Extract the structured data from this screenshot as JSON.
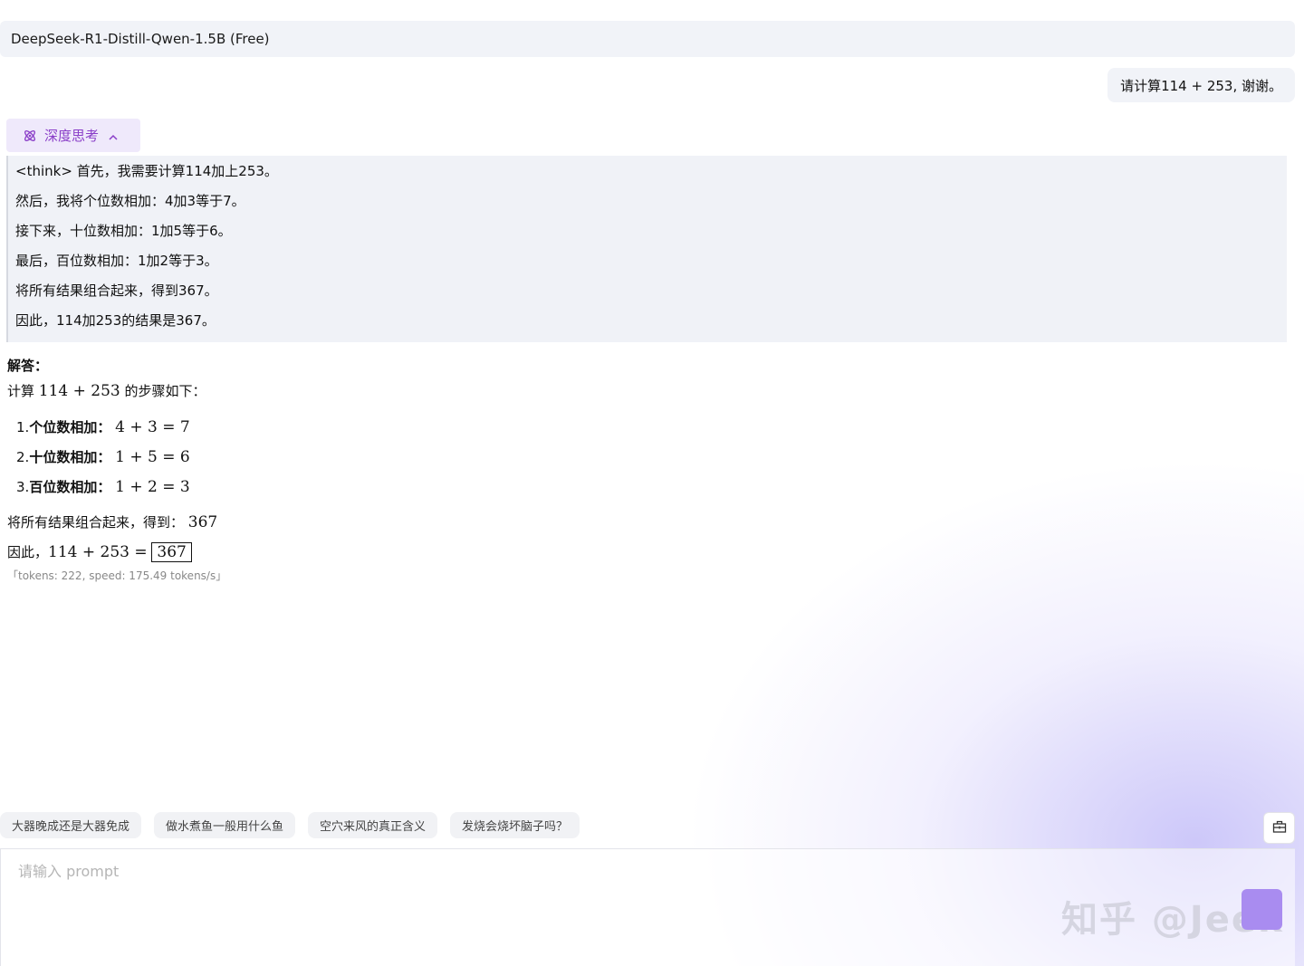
{
  "header": {
    "model_name": "DeepSeek-R1-Distill-Qwen-1.5B (Free)"
  },
  "user_message": "请计算114 + 253, 谢谢。",
  "think": {
    "toggle_label": "深度思考",
    "lines": [
      "<think> 首先，我需要计算114加上253。",
      "然后，我将个位数相加：4加3等于7。",
      "接下来，十位数相加：1加5等于6。",
      "最后，百位数相加：1加2等于3。",
      "将所有结果组合起来，得到367。",
      "因此，114加253的结果是367。"
    ]
  },
  "answer": {
    "heading": "解答：",
    "intro_prefix": "计算 ",
    "intro_math": "114 + 253",
    "intro_suffix": " 的步骤如下：",
    "steps": [
      {
        "num": "1.",
        "label": "个位数相加：",
        "math": "4 + 3 = 7"
      },
      {
        "num": "2.",
        "label": "十位数相加：",
        "math": "1 + 5 = 6"
      },
      {
        "num": "3.",
        "label": "百位数相加：",
        "math": "1 + 2 = 3"
      }
    ],
    "combine_text": "将所有结果组合起来，得到：",
    "combine_math": "367",
    "conclusion_text": "因此，",
    "conclusion_math": "114 + 253 =",
    "boxed_result": "367",
    "stats": "「tokens: 222, speed: 175.49 tokens/s」"
  },
  "suggestions": [
    "大器晚成还是大器免成",
    "做水煮鱼一般用什么鱼",
    "空穴来风的真正含义",
    "发烧会烧坏脑子吗？"
  ],
  "input": {
    "placeholder": "请输入 prompt"
  },
  "watermark": "知乎 @Jeek",
  "colors": {
    "accent": "#8a3ec8",
    "send_button": "#a98cf0",
    "panel_bg": "#f1f3f8"
  },
  "icons": {
    "think": "atom-icon",
    "collapse": "chevron-up-icon",
    "tool": "toolbox-icon",
    "send": "send-icon"
  }
}
